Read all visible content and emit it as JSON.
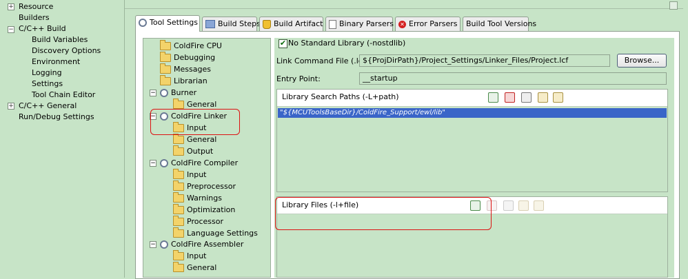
{
  "left_tree": [
    {
      "label": "Resource",
      "expander": "+"
    },
    {
      "label": "Builders",
      "expander": ""
    },
    {
      "label": "C/C++ Build",
      "expander": "−"
    },
    {
      "label": "Build Variables",
      "expander": ""
    },
    {
      "label": "Discovery Options",
      "expander": ""
    },
    {
      "label": "Environment",
      "expander": ""
    },
    {
      "label": "Logging",
      "expander": ""
    },
    {
      "label": "Settings",
      "expander": ""
    },
    {
      "label": "Tool Chain Editor",
      "expander": ""
    },
    {
      "label": "C/C++ General",
      "expander": "+"
    },
    {
      "label": "Run/Debug Settings",
      "expander": ""
    }
  ],
  "tabs": [
    "Tool Settings",
    "Build Steps",
    "Build Artifact",
    "Binary Parsers",
    "Error Parsers",
    "Build Tool Versions"
  ],
  "tool_tree": [
    {
      "label": "ColdFire CPU",
      "kind": "folder"
    },
    {
      "label": "Debugging",
      "kind": "folder"
    },
    {
      "label": "Messages",
      "kind": "folder"
    },
    {
      "label": "Librarian",
      "kind": "folder"
    },
    {
      "label": "Burner",
      "kind": "gear"
    },
    {
      "label": "General",
      "kind": "folder"
    },
    {
      "label": "ColdFire Linker",
      "kind": "gear"
    },
    {
      "label": "Input",
      "kind": "folder"
    },
    {
      "label": "General",
      "kind": "folder"
    },
    {
      "label": "Output",
      "kind": "folder"
    },
    {
      "label": "ColdFire Compiler",
      "kind": "gear"
    },
    {
      "label": "Input",
      "kind": "folder"
    },
    {
      "label": "Preprocessor",
      "kind": "folder"
    },
    {
      "label": "Warnings",
      "kind": "folder"
    },
    {
      "label": "Optimization",
      "kind": "folder"
    },
    {
      "label": "Processor",
      "kind": "folder"
    },
    {
      "label": "Language Settings",
      "kind": "folder"
    },
    {
      "label": "ColdFire Assembler",
      "kind": "gear"
    },
    {
      "label": "Input",
      "kind": "folder"
    },
    {
      "label": "General",
      "kind": "folder"
    }
  ],
  "settings": {
    "no_std_lib": "No Standard Library (-nostdlib)",
    "lcf_label": "Link Command File (.lcf)",
    "lcf_value": "${ProjDirPath}/Project_Settings/Linker_Files/Project.lcf",
    "browse": "Browse...",
    "entry_label": "Entry Point:",
    "entry_value": "__startup",
    "search_paths_title": "Library Search Paths (-L+path)",
    "search_path_item": "\"${MCUToolsBaseDir}/ColdFire_Support/ewl/lib\"",
    "lib_files_title": "Library Files (-l+file)"
  }
}
